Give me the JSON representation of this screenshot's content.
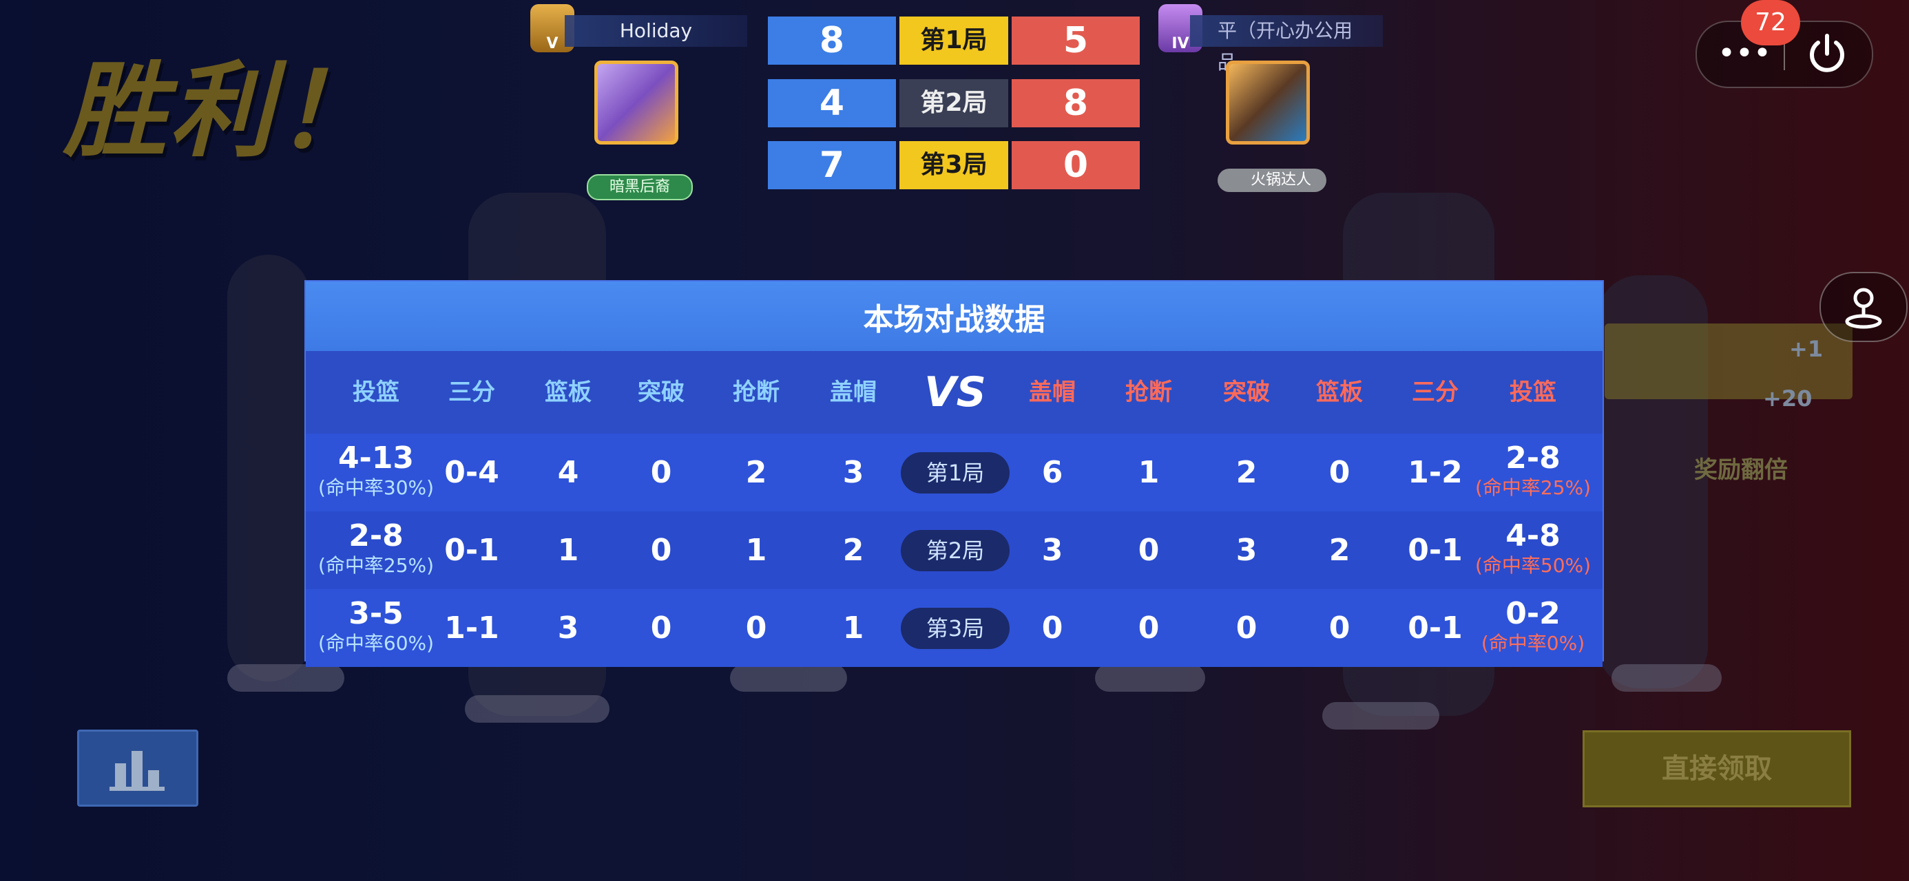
{
  "victory_text": "胜利！",
  "left_team": {
    "name": "Holiday",
    "rank_badge": "V",
    "title_tag": "暗黑后裔"
  },
  "right_team": {
    "name": "平（开心办公用品..",
    "rank_badge": "IV",
    "title_tag": "火锅达人"
  },
  "scoreboard": [
    {
      "left": "8",
      "label": "第1局",
      "right": "5",
      "winner": "left"
    },
    {
      "left": "4",
      "label": "第2局",
      "right": "8",
      "winner": "right"
    },
    {
      "left": "7",
      "label": "第3局",
      "right": "0",
      "winner": "left"
    }
  ],
  "stats": {
    "title": "本场对战数据",
    "vs_label": "VS",
    "left_headers": [
      "投篮",
      "三分",
      "篮板",
      "突破",
      "抢断",
      "盖帽"
    ],
    "right_headers": [
      "盖帽",
      "抢断",
      "突破",
      "篮板",
      "三分",
      "投篮"
    ],
    "rounds": [
      {
        "label": "第1局",
        "left": {
          "shot": "4-13",
          "pct": "(命中率30%)",
          "three": "0-4",
          "rebound": "4",
          "drive": "0",
          "steal": "2",
          "block": "3"
        },
        "right": {
          "block": "6",
          "steal": "1",
          "drive": "2",
          "rebound": "0",
          "three": "1-2",
          "shot": "2-8",
          "pct": "(命中率25%)"
        }
      },
      {
        "label": "第2局",
        "left": {
          "shot": "2-8",
          "pct": "(命中率25%)",
          "three": "0-1",
          "rebound": "1",
          "drive": "0",
          "steal": "1",
          "block": "2"
        },
        "right": {
          "block": "3",
          "steal": "0",
          "drive": "3",
          "rebound": "2",
          "three": "0-1",
          "shot": "4-8",
          "pct": "(命中率50%)"
        }
      },
      {
        "label": "第3局",
        "left": {
          "shot": "3-5",
          "pct": "(命中率60%)",
          "three": "1-1",
          "rebound": "3",
          "drive": "0",
          "steal": "0",
          "block": "1"
        },
        "right": {
          "block": "0",
          "steal": "0",
          "drive": "0",
          "rebound": "0",
          "three": "0-1",
          "shot": "0-2",
          "pct": "(命中率0%)"
        }
      }
    ]
  },
  "side_panel": {
    "reward_double": "奖励翻倍",
    "plus_one": "+1",
    "plus_twenty": "+20"
  },
  "controls": {
    "notification_count": "72",
    "more_icon": "more-dots-icon",
    "power_icon": "power-icon",
    "joystick_icon": "joystick-icon",
    "stats_icon": "bar-chart-icon",
    "claim_label": "直接领取"
  },
  "colors": {
    "blue_team": "#3c7ee6",
    "red_team": "#e25a4f",
    "round_win": "#f2c71e",
    "panel": "#2d50c8"
  }
}
